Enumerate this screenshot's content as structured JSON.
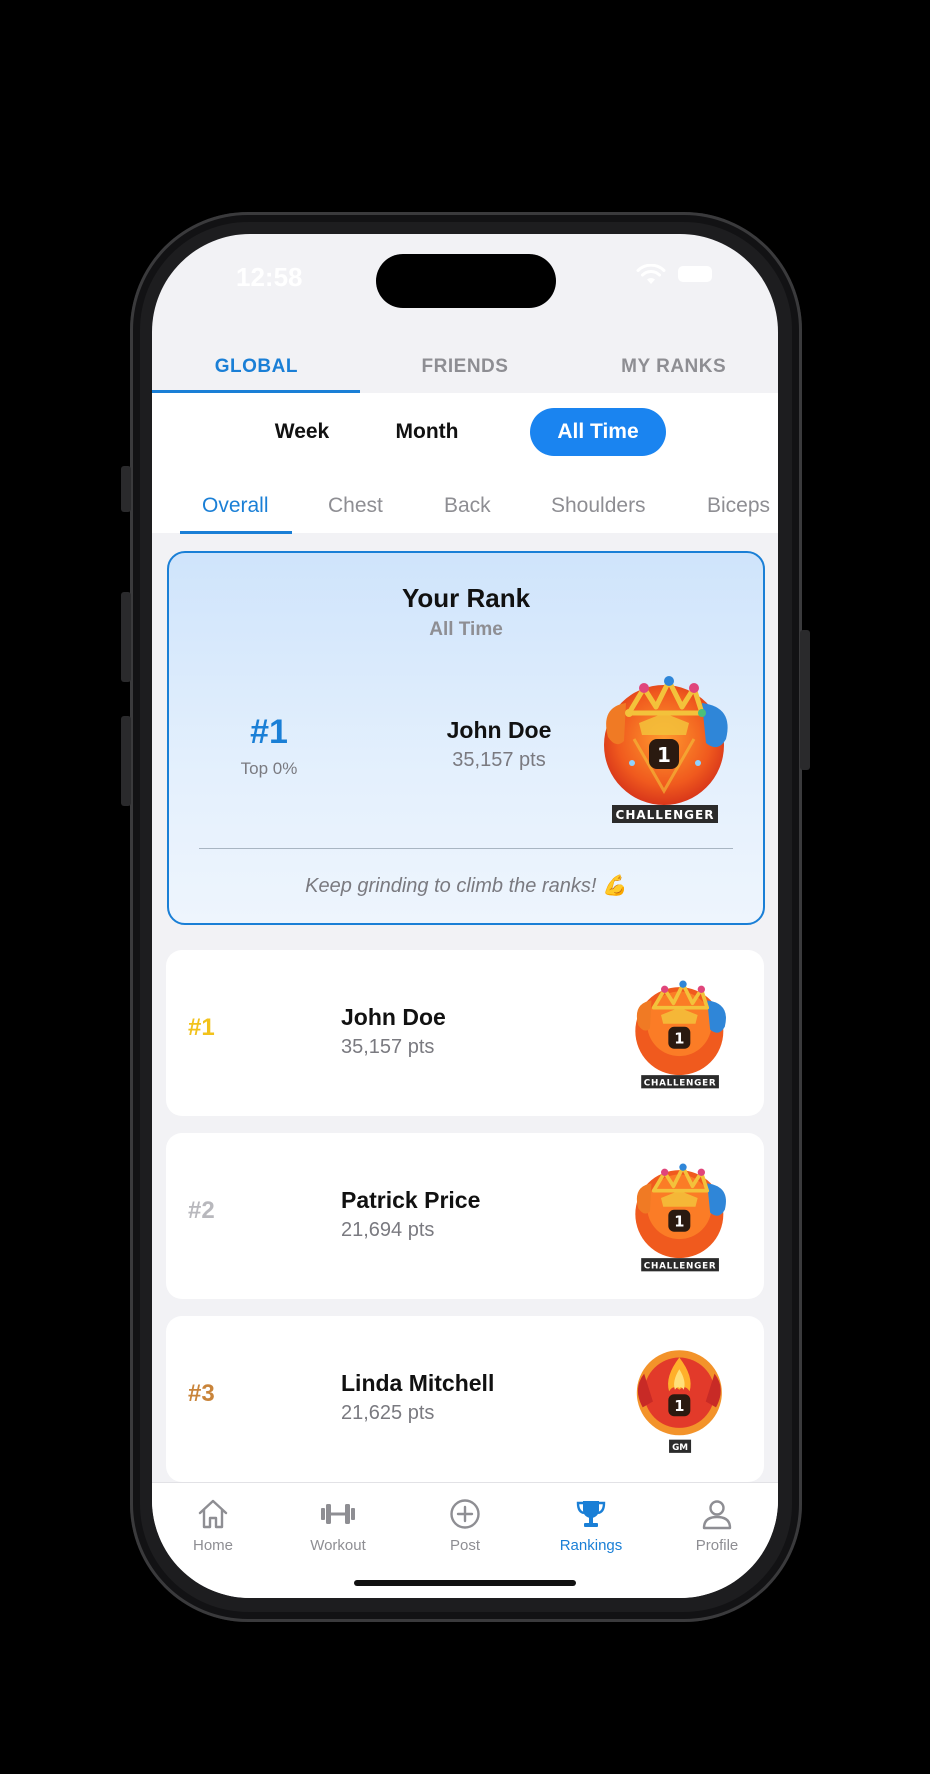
{
  "status_bar": {
    "time": "12:58"
  },
  "top_tabs": [
    {
      "label": "GLOBAL",
      "active": true
    },
    {
      "label": "FRIENDS",
      "active": false
    },
    {
      "label": "MY RANKS",
      "active": false
    }
  ],
  "periods": [
    {
      "label": "Week",
      "active": false
    },
    {
      "label": "Month",
      "active": false
    },
    {
      "label": "All Time",
      "active": true
    }
  ],
  "categories": [
    {
      "label": "Overall",
      "active": true
    },
    {
      "label": "Chest",
      "active": false
    },
    {
      "label": "Back",
      "active": false
    },
    {
      "label": "Shoulders",
      "active": false
    },
    {
      "label": "Biceps",
      "active": false
    }
  ],
  "your_rank": {
    "title": "Your Rank",
    "subtitle": "All Time",
    "rank": "#1",
    "top_percent": "Top 0%",
    "name": "John Doe",
    "points": "35,157 pts",
    "badge_label": "CHALLENGER",
    "badge_number": "1",
    "message": "Keep grinding to climb the ranks! 💪"
  },
  "leaderboard": [
    {
      "rank": "#1",
      "rank_color": "#f2c21b",
      "name": "John Doe",
      "points": "35,157 pts",
      "badge_label": "CHALLENGER",
      "badge_number": "1"
    },
    {
      "rank": "#2",
      "rank_color": "#b8b8bd",
      "name": "Patrick Price",
      "points": "21,694 pts",
      "badge_label": "CHALLENGER",
      "badge_number": "1"
    },
    {
      "rank": "#3",
      "rank_color": "#c9843a",
      "name": "Linda Mitchell",
      "points": "21,625 pts",
      "badge_label": "GM",
      "badge_number": "1"
    }
  ],
  "bottom_nav": [
    {
      "label": "Home",
      "icon": "home-icon",
      "active": false
    },
    {
      "label": "Workout",
      "icon": "dumbbell-icon",
      "active": false
    },
    {
      "label": "Post",
      "icon": "plus-circle-icon",
      "active": false
    },
    {
      "label": "Rankings",
      "icon": "trophy-icon",
      "active": true
    },
    {
      "label": "Profile",
      "icon": "person-icon",
      "active": false
    }
  ],
  "colors": {
    "accent": "#1a7fd6",
    "gold": "#f2c21b",
    "silver": "#b8b8bd",
    "bronze": "#c9843a"
  }
}
